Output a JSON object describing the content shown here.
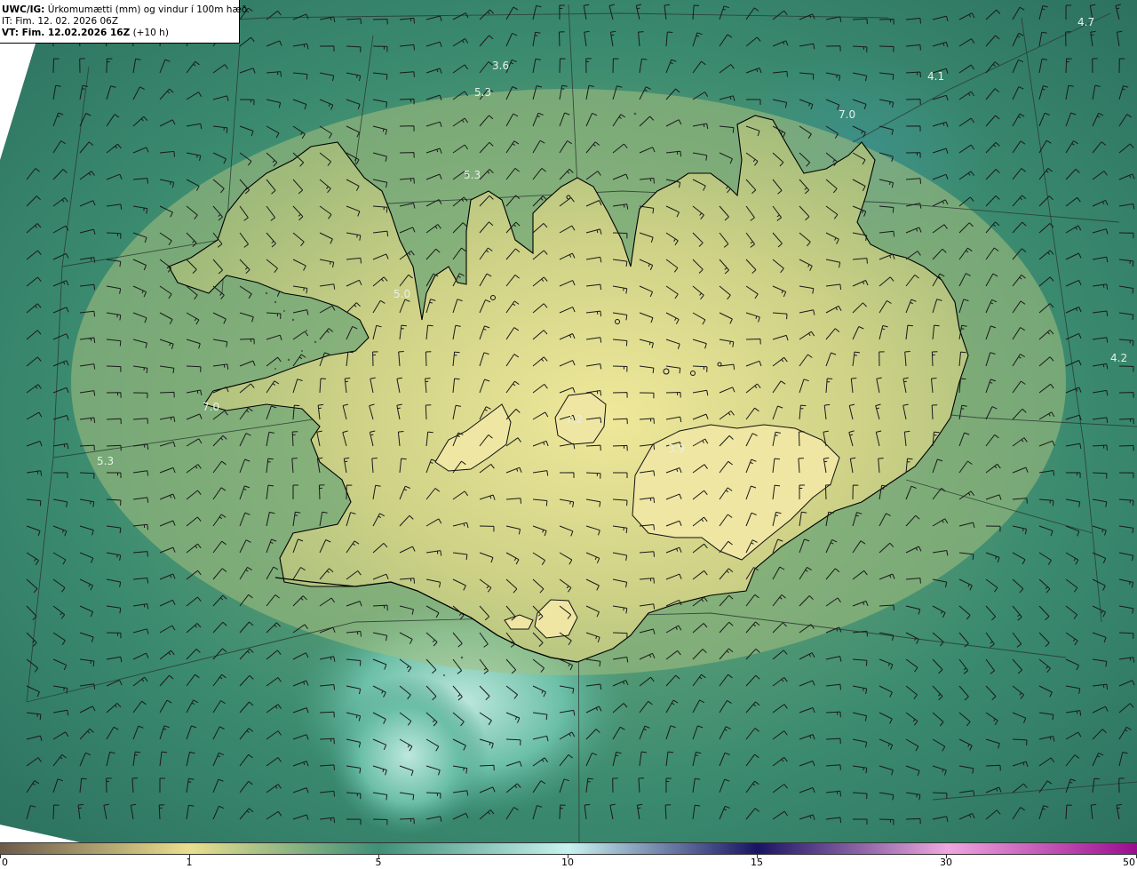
{
  "header": {
    "model_label": "UWC/IG:",
    "title": "Úrkomumætti (mm) og vindur í 100m hæð",
    "init_time": "IT: Fim. 12. 02. 2026 06Z",
    "valid_prefix": "VT: Fim. 12.02.2026 16Z",
    "valid_suffix": "(+10 h)"
  },
  "colorbar": {
    "ticks": [
      "0",
      "1",
      "5",
      "10",
      "15",
      "30",
      "50"
    ],
    "colors": {
      "0": "#6b5a4a",
      "1": "#eadf8e",
      "5": "#3f8f78",
      "10": "#c9f2ef",
      "15": "#191463",
      "30": "#f0a7df",
      "50": "#9a0c8f"
    }
  },
  "labels": [
    "3.6",
    "5.3",
    "5.3",
    "7.0",
    "4.1",
    "5.0",
    "4.2",
    "5.3",
    "7.0",
    "3.9",
    "7.2",
    "4.7"
  ],
  "colors": {
    "land_fill": "#dedd8c",
    "sea_fill": "#2f7a67",
    "coastline": "#000000",
    "wind_barb": "#1a1a1a"
  }
}
